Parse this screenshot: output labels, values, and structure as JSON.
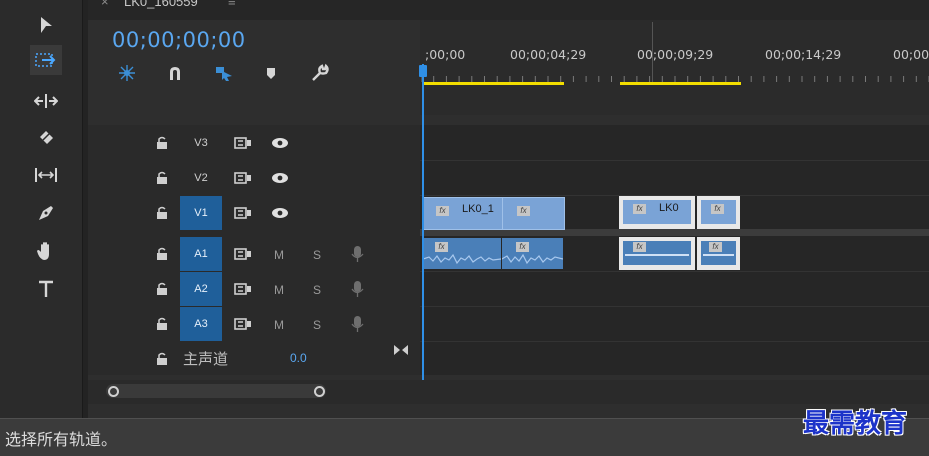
{
  "sequence_tab": {
    "close": "×",
    "name": "LK0_160559",
    "menu": "≡"
  },
  "timecode": "00;00;00;00",
  "header_tools": [
    "snap-nest-icon",
    "magnet-icon",
    "linked-selection-icon",
    "marker-icon",
    "wrench-icon"
  ],
  "ruler": {
    "labels": [
      ";00;00",
      "00;00;04;29",
      "00;00;09;29",
      "00;00;14;29",
      "00;00"
    ]
  },
  "work_area_color": "#f2dd00",
  "tracks": {
    "video": [
      {
        "name": "V3",
        "targeted": false
      },
      {
        "name": "V2",
        "targeted": false
      },
      {
        "name": "V1",
        "targeted": true
      }
    ],
    "audio": [
      {
        "name": "A1",
        "m": "M",
        "s": "S"
      },
      {
        "name": "A2",
        "m": "M",
        "s": "S"
      },
      {
        "name": "A3",
        "m": "M",
        "s": "S"
      }
    ],
    "master": {
      "label": "主声道",
      "value": "0.0"
    }
  },
  "clips": {
    "v1_first": {
      "label": "LK0_1",
      "fx": "fx"
    },
    "v1_second": {
      "label": "LK0",
      "fx": "fx"
    }
  },
  "tools": [
    "selection-tool-icon",
    "track-select-forward-icon",
    "ripple-edit-icon",
    "razor-icon",
    "slip-icon",
    "pen-icon",
    "hand-icon",
    "type-icon"
  ],
  "status": "选择所有轨道。",
  "watermark": "最需教育",
  "colors": {
    "accent": "#2f8fe6",
    "clip_video": "#7aa3d6",
    "track_target": "#1f5f9a"
  }
}
